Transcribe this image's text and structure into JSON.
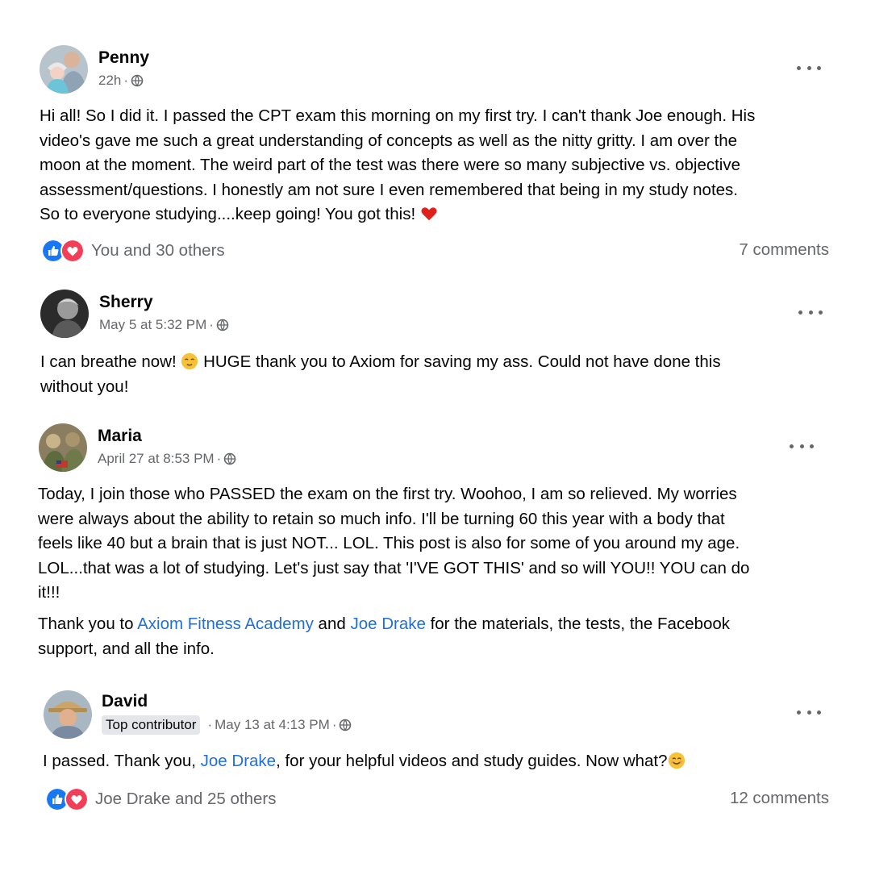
{
  "posts": [
    {
      "author": "Penny",
      "time": "22h",
      "lines": [
        "Hi all! So I did it. I passed the CPT exam this morning on my first try. I can't thank Joe enough. His",
        "video's gave me such a great understanding of concepts as well as the nitty gritty. I am over the",
        "moon at the moment. The weird part of the test was there were so many subjective vs. objective",
        "assessment/questions. I honestly am not sure I even remembered that being in my study notes.",
        "So to everyone studying....keep going! You got this! "
      ],
      "reactions_text": "You and 30 others",
      "comments_text": "7 comments"
    },
    {
      "author": "Sherry",
      "time": "May 5 at 5:32 PM",
      "lines": [
        "I can breathe now! ",
        " HUGE thank you to Axiom for saving my ass.  Could not have done this",
        "without you!"
      ]
    },
    {
      "author": "Maria",
      "time": "April 27 at 8:53 PM",
      "lines": [
        "Today, I join those who PASSED the exam on the first try. Woohoo, I am so relieved. My worries",
        "were always about the ability to retain so much info. I'll be turning 60 this year with a body that",
        "feels like 40 but a brain that is just NOT... LOL. This post is also for some of you around my age.",
        "LOL...that was a lot of studying. Let's just say that 'I'VE GOT THIS' and so will YOU!! YOU can do",
        "it!!!"
      ],
      "thanks_prefix": "Thank you to ",
      "link1": "Axiom Fitness Academy",
      "and_text": " and ",
      "link2": "Joe Drake",
      "thanks_suffix": " for the materials, the tests, the Facebook",
      "thanks_line2": "support, and all the info."
    },
    {
      "author": "David",
      "badge": "Top contributor",
      "time": "May 13 at 4:13 PM",
      "text_prefix": "I passed. Thank you, ",
      "link": "Joe Drake",
      "text_suffix": ", for your helpful videos and study guides. Now what?",
      "reactions_text": "Joe Drake and 25 others",
      "comments_text": "12 comments"
    }
  ],
  "colors": {
    "link": "#216fdb",
    "like": "#1877f2",
    "love": "#f33e58",
    "secondary": "#65676b"
  },
  "icons": [
    "globe-icon",
    "more-options-icon",
    "like-reaction-icon",
    "love-reaction-icon",
    "red-heart-emoji",
    "smiling-emoji"
  ]
}
